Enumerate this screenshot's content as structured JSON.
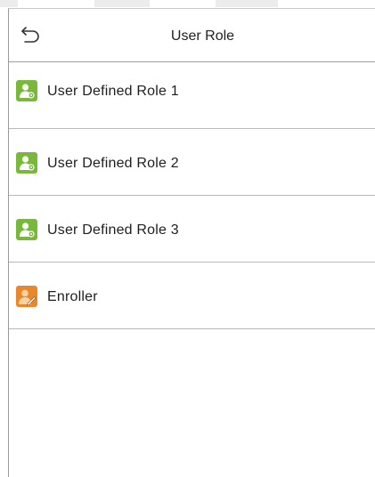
{
  "header": {
    "title": "User Role",
    "back_icon": "back-arrow-icon"
  },
  "roles": [
    {
      "label": "User Defined Role 1",
      "icon": "user-role-icon",
      "icon_color": "#78b83a"
    },
    {
      "label": "User Defined Role 2",
      "icon": "user-role-icon",
      "icon_color": "#78b83a"
    },
    {
      "label": "User Defined Role 3",
      "icon": "user-role-icon",
      "icon_color": "#78b83a"
    },
    {
      "label": "Enroller",
      "icon": "enroller-icon",
      "icon_color": "#e8882a"
    }
  ]
}
